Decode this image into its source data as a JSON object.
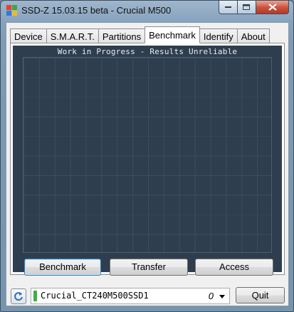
{
  "window": {
    "title": "SSD-Z 15.03.15 beta - Crucial M500"
  },
  "tabs": [
    {
      "label": "Device"
    },
    {
      "label": "S.M.A.R.T."
    },
    {
      "label": "Partitions"
    },
    {
      "label": "Benchmark",
      "active": true
    },
    {
      "label": "Identify"
    },
    {
      "label": "About"
    }
  ],
  "benchmark": {
    "chart_title": "Work in Progress - Results Unreliable",
    "buttons": {
      "benchmark": "Benchmark",
      "transfer": "Transfer",
      "access": "Access"
    }
  },
  "footer": {
    "drive_name": "Crucial_CT240M500SSD1",
    "drive_index": "0",
    "quit_label": "Quit"
  },
  "colors": {
    "chart_bg": "#2f3e4f",
    "drive_status": "#3cb043"
  }
}
